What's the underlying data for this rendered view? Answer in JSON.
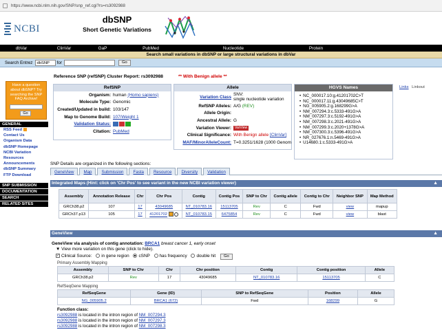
{
  "browser": {
    "url": "https://www.ncbi.nlm.nih.gov/SNP/snp_ref.cgi?rs=rs3092988"
  },
  "header": {
    "logo": "NCBI",
    "title": "dbSNP",
    "subtitle": "Short Genetic Variations"
  },
  "nav": [
    "dbVar",
    "ClinVar",
    "GaP",
    "PubMed",
    "Nucleotide",
    "Protein"
  ],
  "search": {
    "note": "Search small variations in dbSNP or large structural variations in dbVar",
    "label": "Search Entrez",
    "db": "dbSNP",
    "for_label": "for",
    "go": "Go"
  },
  "promo": {
    "text": "Have a question about dbSNP? Try searching the SNP FAQ Archive!",
    "go": "Go"
  },
  "sidebar": {
    "general": "GENERAL",
    "links": [
      "RSS Feed",
      "Contact Us",
      "Organism Data",
      "dbSNP Homepage",
      "NCBI Variation Resources",
      "Announcements",
      "dbSNP Summary",
      "FTP Download"
    ],
    "sections": [
      "SNP SUBMISSION",
      "DOCUMENTATION",
      "SEARCH",
      "RELATED SITES"
    ]
  },
  "report": {
    "title": "Reference SNP (refSNP) Cluster Report: rs3092988",
    "benign": "** With Benign allele **"
  },
  "refsnp": {
    "header": "RefSNP",
    "rows": [
      {
        "k": "Organism:",
        "v": "human ",
        "link": "(Homo sapiens)"
      },
      {
        "k": "Molecule Type:",
        "v": "Genomic"
      },
      {
        "k": "Created/Updated in build:",
        "v": "103/147"
      },
      {
        "k": "Map to Genome Build:",
        "v": "",
        "link": "107/Weight 1"
      },
      {
        "k": "Validation Status:",
        "v": "",
        "link": ""
      },
      {
        "k": "Citation:",
        "v": "",
        "link": "PubMed"
      }
    ]
  },
  "allele": {
    "header": "Allele",
    "variation_class": "Variation Class",
    "variation_value1": "SNV:",
    "variation_value2": "single nucleotide variation",
    "refsnp_alleles_label": "RefSNP Alleles:",
    "refsnp_alleles_value": "A/G ",
    "refsnp_alleles_rev": "(REV)",
    "origin_label": "Allele Origin:",
    "ancestral_label": "Ancestral Allele:",
    "ancestral_value": "G",
    "viewer_label": "Variation Viewer:",
    "viewer_btn": "VarView",
    "clinical_label": "Clinical Significance:",
    "clinical_value": "With Benign allele ",
    "clinical_link": "[ClinVar]",
    "maf_label": "MAF/MinorAlleleCount:",
    "maf_value": "T=0.3251/1628 (1000 Genomes)"
  },
  "hgvs": {
    "header": "HGVS Names",
    "names": [
      "NC_000017.10:g.41201702C>T",
      "NC_000017.11:g.43049685C>T",
      "NG_005905.2:g.168299G>A",
      "NM_007294.3:c.5333-491G>A",
      "NM_007297.3:c.5192-491G>A",
      "NM_007298.3:c.2021-491G>A",
      "NM_007299.3:c.2020+1378G>A",
      "NM_007300.3:c.5396-491G>A",
      "NR_027676.1:n.5469-491G>A",
      "U14680.1:c.5333-491G>A"
    ]
  },
  "topright": {
    "a": "Links",
    "b": "Linkout"
  },
  "tabs": {
    "label": "SNP Details are organized in the following sections:",
    "items": [
      "GeneView",
      "Map",
      "Submission",
      "Fasta",
      "Resource",
      "Diversity",
      "Validation"
    ]
  },
  "maps": {
    "header": "Integrated Maps (Hint: click on 'Chr Pos' to see variant in the new NCBI variation viewer)",
    "columns": [
      "Assembly",
      "Annotation Release",
      "Chr",
      "Chr Pos",
      "Contig",
      "Contig Pos",
      "SNP to Chr",
      "Contig allele",
      "Contig to Chr",
      "Neighbor SNP",
      "Map Method"
    ],
    "rows": [
      [
        "GRCh38.p2",
        "107",
        "17",
        "43049685",
        "NT_010783.16",
        "15113705",
        "Rev",
        "C",
        "Fwd",
        "view",
        "mapup"
      ],
      [
        "GRCh37.p13",
        "105",
        "17",
        "41201702",
        "NT_010783.15",
        "6475854",
        "Rev",
        "C",
        "Fwd",
        "view",
        "blast"
      ]
    ]
  },
  "geneview": {
    "header": "GeneView",
    "annot_label": "GeneView via analysis of contig annotation: ",
    "annot_link": "BRCA1",
    "annot_rest": " breast cancer 1, early onset",
    "more": "View more variation on this gene (click to hide).",
    "clinical": "Clinical Source:",
    "radios": [
      "in gene region",
      "cSNP",
      "has frequency",
      "double hit"
    ],
    "go": "Go",
    "primary_label": "Primary Assembly Mapping",
    "primary_cols": [
      "Assembly",
      "SNP to Chr",
      "Chr",
      "Chr position",
      "Contig",
      "Contig position",
      "Allele"
    ],
    "primary_row": [
      "GRCh38.p2",
      "Rev",
      "17",
      "43049685",
      "NT_010783.16",
      "15113705",
      "C"
    ],
    "refseq_label": "RefSeqGene Mapping",
    "refseq_cols": [
      "RefSeqGene",
      "Gene (ID)",
      "SNP to RefSeqGene",
      "Position",
      "Allele"
    ],
    "refseq_row": [
      "NG_005905.2",
      "BRCA1 (672)",
      "Fwd",
      "168299",
      "G"
    ]
  },
  "function": {
    "label": "Function class:",
    "lines": [
      {
        "rs": "rs3092988",
        "text": " is located in the intron region of ",
        "nm": "NM_007294.3"
      },
      {
        "rs": "rs3092988",
        "text": " is located in the intron region of ",
        "nm": "NM_007297.3"
      },
      {
        "rs": "rs3092988",
        "text": " is located in the intron region of ",
        "nm": "NM_007298.3"
      }
    ]
  }
}
